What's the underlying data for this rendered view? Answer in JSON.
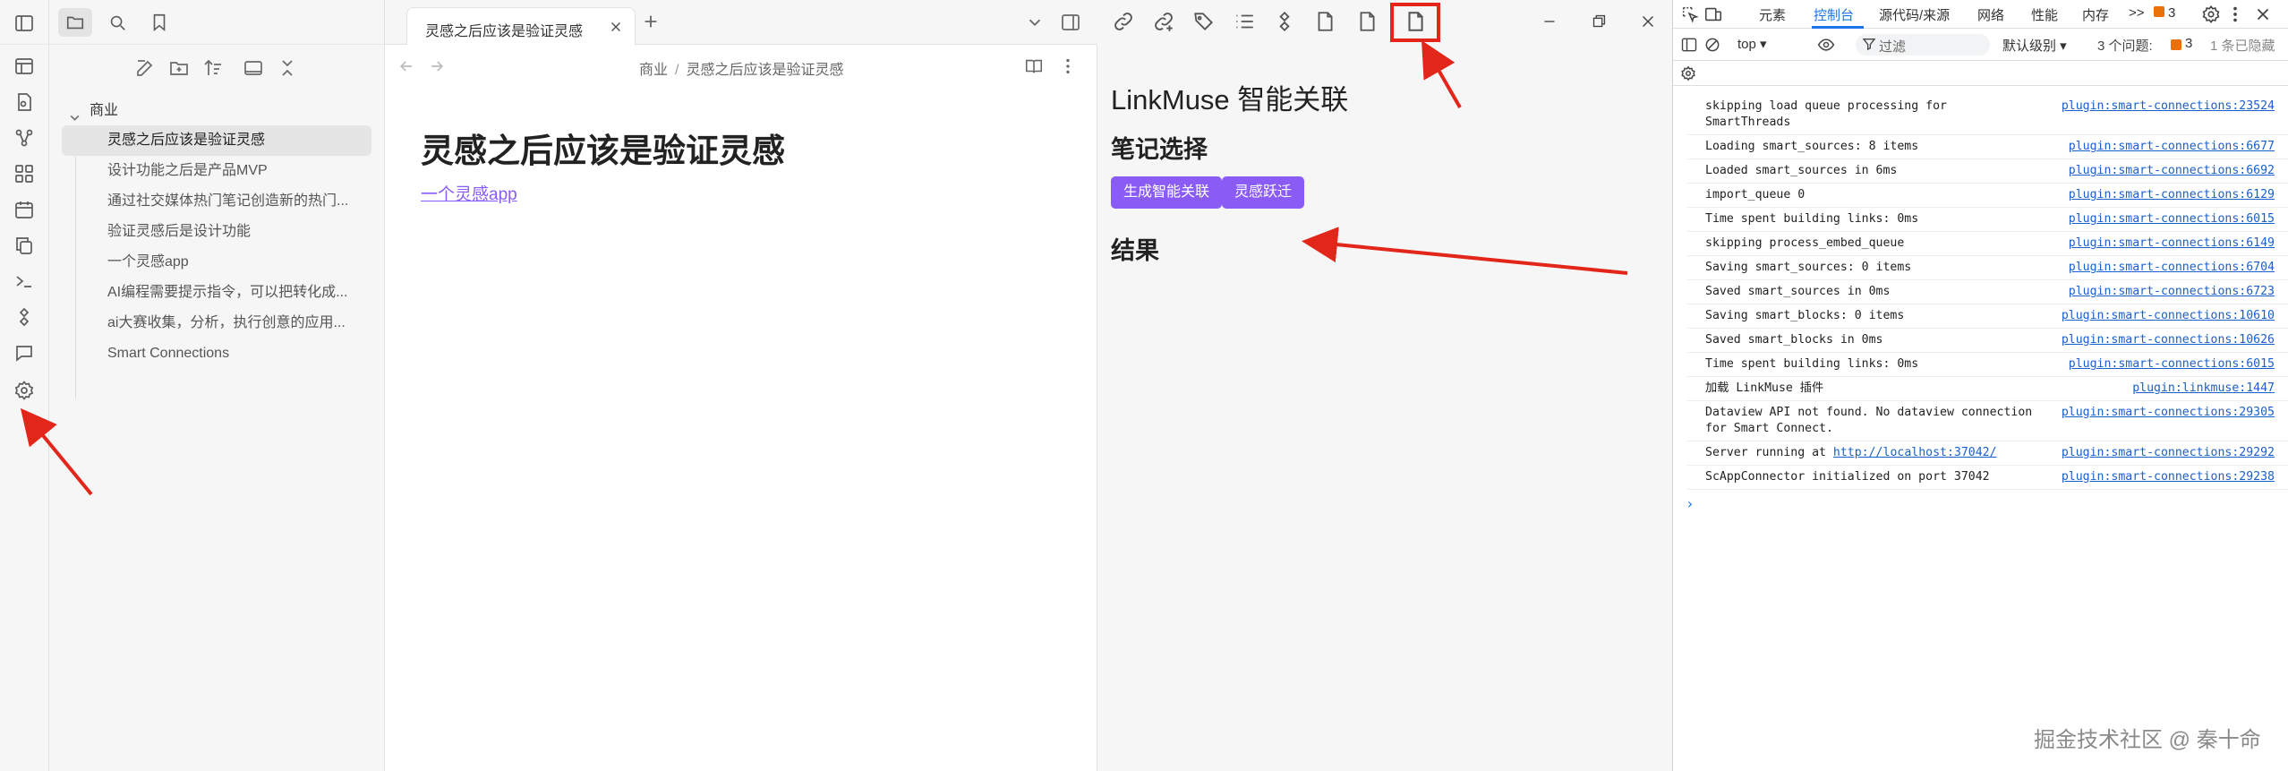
{
  "sidebar": {
    "folder": "商业",
    "files": [
      "灵感之后应该是验证灵感",
      "设计功能之后是产品MVP",
      "通过社交媒体热门笔记创造新的热门...",
      "验证灵感后是设计功能",
      "一个灵感app",
      "AI编程需要提示指令，可以把转化成...",
      "ai大赛收集，分析，执行创意的应用...",
      "Smart Connections"
    ]
  },
  "tab": {
    "title": "灵感之后应该是验证灵感"
  },
  "breadcrumb": {
    "parent": "商业",
    "sep": "/",
    "current": "灵感之后应该是验证灵感"
  },
  "note": {
    "title": "灵感之后应该是验证灵感",
    "link": "一个灵感app"
  },
  "plugin": {
    "title": "LinkMuse 智能关联",
    "section_select": "笔记选择",
    "btn_generate": "生成智能关联",
    "btn_jump": "灵感跃迁",
    "section_result": "结果"
  },
  "devtools": {
    "tabs": [
      "元素",
      "控制台",
      "源代码/来源",
      "网络",
      "性能",
      "内存"
    ],
    "more": ">>",
    "warn_count": "3",
    "context": "top ▾",
    "filter_placeholder": "过滤",
    "level": "默认级别 ▾",
    "issues_label": "3 个问题:",
    "issues_count": "3",
    "hidden": "1 条已隐藏",
    "logs": [
      {
        "msg": "skipping load queue processing for\nSmartThreads",
        "src": "plugin:smart-connections:23524"
      },
      {
        "msg": "Loading smart_sources: 8 items",
        "src": "plugin:smart-connections:6677"
      },
      {
        "msg": "Loaded smart_sources in 6ms",
        "src": "plugin:smart-connections:6692"
      },
      {
        "msg": "import_queue 0",
        "src": "plugin:smart-connections:6129"
      },
      {
        "msg": "Time spent building links: 0ms",
        "src": "plugin:smart-connections:6015"
      },
      {
        "msg": "skipping process_embed_queue",
        "src": "plugin:smart-connections:6149"
      },
      {
        "msg": "Saving smart_sources: 0 items",
        "src": "plugin:smart-connections:6704"
      },
      {
        "msg": "Saved smart_sources in 0ms",
        "src": "plugin:smart-connections:6723"
      },
      {
        "msg": "Saving smart_blocks: 0 items",
        "src": "plugin:smart-connections:10610"
      },
      {
        "msg": "Saved smart_blocks in 0ms",
        "src": "plugin:smart-connections:10626"
      },
      {
        "msg": "Time spent building links: 0ms",
        "src": "plugin:smart-connections:6015"
      },
      {
        "msg": "加载 LinkMuse 插件",
        "src": "plugin:linkmuse:1447"
      },
      {
        "msg": "Dataview API not found. No dataview connection\nfor Smart Connect.",
        "src": "plugin:smart-connections:29305"
      },
      {
        "msg_prefix": "Server running at ",
        "msg_link": "http://localhost:37042/",
        "src": "plugin:smart-connections:29292"
      },
      {
        "msg": "ScAppConnector initialized on port 37042",
        "src": "plugin:smart-connections:29238"
      }
    ],
    "prompt": "›"
  },
  "watermark": "掘金技术社区 @ 秦十命",
  "colors": {
    "accent": "#8a5cf5",
    "annotation": "#e3261a",
    "devtools_blue": "#1a73e8"
  }
}
